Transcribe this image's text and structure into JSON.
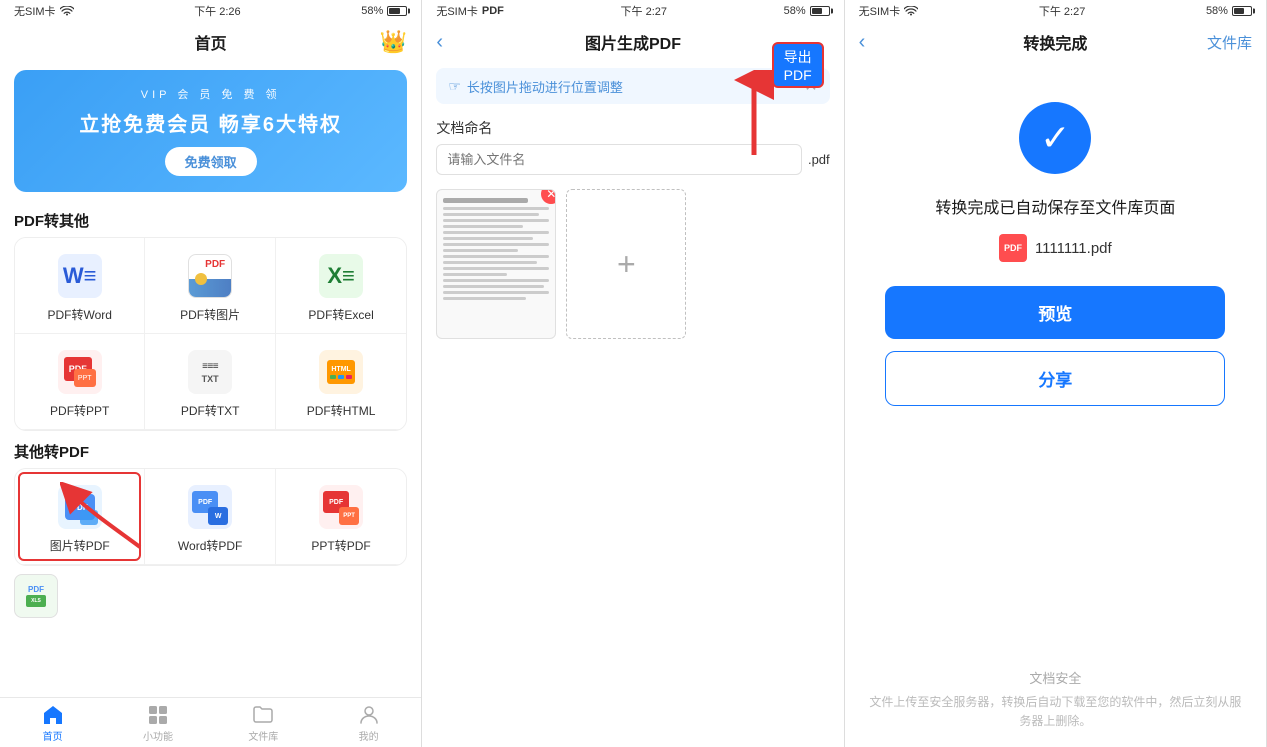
{
  "screen1": {
    "status": {
      "carrier": "无SIM卡",
      "wifi": "WiFi",
      "time": "下午 2:26",
      "battery": "58%"
    },
    "title": "首页",
    "banner": {
      "vip_tag": "VIP 会 员 免 费 领",
      "main_text": "立抢免费会员  畅享6大特权",
      "btn_label": "免费领取"
    },
    "section1_label": "PDF转其他",
    "tools_pdf": [
      {
        "label": "PDF转Word",
        "icon": "word-icon"
      },
      {
        "label": "PDF转图片",
        "icon": "image-icon"
      },
      {
        "label": "PDF转Excel",
        "icon": "excel-icon"
      },
      {
        "label": "PDF转PPT",
        "icon": "ppt-icon"
      },
      {
        "label": "PDF转TXT",
        "icon": "txt-icon"
      },
      {
        "label": "PDF转HTML",
        "icon": "html-icon"
      }
    ],
    "section2_label": "其他转PDF",
    "tools_other": [
      {
        "label": "图片转PDF",
        "icon": "img2pdf-icon",
        "highlighted": true
      },
      {
        "label": "Word转PDF",
        "icon": "word2pdf-icon"
      },
      {
        "label": "PPT转PDF",
        "icon": "ppt2pdf-icon"
      }
    ],
    "tabs": [
      {
        "label": "首页",
        "icon": "home",
        "active": true
      },
      {
        "label": "小功能",
        "icon": "grid"
      },
      {
        "label": "文件库",
        "icon": "folder"
      },
      {
        "label": "我的",
        "icon": "person"
      }
    ]
  },
  "screen2": {
    "status": {
      "carrier": "无SIM卡",
      "wifi": "PDF",
      "time": "下午 2:27",
      "battery": "58%"
    },
    "title": "图片生成PDF",
    "export_btn": "导出PDF",
    "hint": "长按图片拖动进行位置调整",
    "doc_name_label": "文档命名",
    "input_placeholder": "请输入文件名",
    "input_ext": ".pdf",
    "arrow_label": "导出PDF箭头"
  },
  "screen3": {
    "status": {
      "carrier": "无SIM卡",
      "wifi": "WiFi",
      "time": "下午 2:27",
      "battery": "58%"
    },
    "title": "转换完成",
    "file_library": "文件库",
    "success_msg": "转换完成已自动保存至文件库页面",
    "file_name": "1111111.pdf",
    "preview_btn": "预览",
    "share_btn": "分享",
    "security_title": "文档安全",
    "security_desc": "文件上传至安全服务器，转换后自动下载至您的软件中，然后立刻从服务器上删除。"
  }
}
